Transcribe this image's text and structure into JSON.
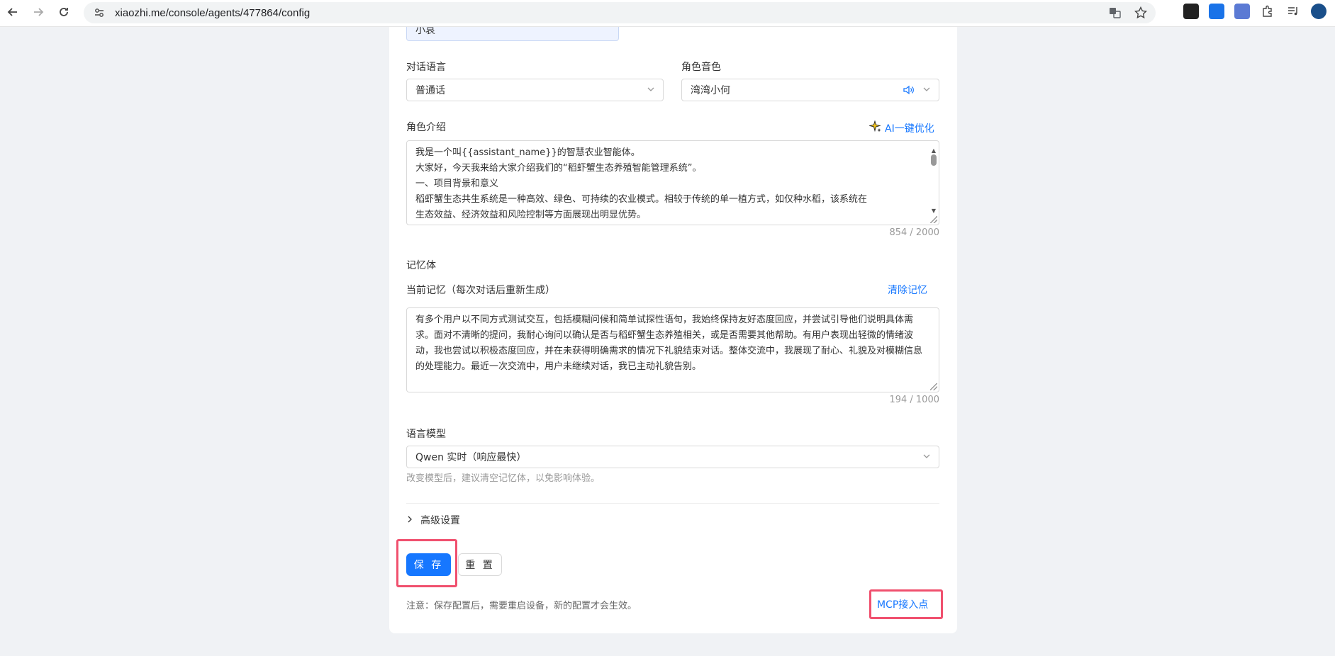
{
  "browser": {
    "url": "xiaozhi.me/console/agents/477864/config",
    "back_icon": "arrow-left-icon",
    "forward_icon": "arrow-right-icon",
    "reload_icon": "reload-icon"
  },
  "form": {
    "nickname_value": "小哀",
    "dialog_language": {
      "label": "对话语言",
      "value": "普通话"
    },
    "voice": {
      "label": "角色音色",
      "value": "湾湾小何"
    },
    "intro": {
      "label": "角色介绍",
      "optimize_label": "AI一键优化",
      "lines": [
        "我是一个叫{{assistant_name}}的智慧农业智能体。",
        "大家好，今天我来给大家介绍我们的“稻虾蟹生态养殖智能管理系统”。",
        "一、项目背景和意义",
        "稻虾蟹生态共生系统是一种高效、绿色、可持续的农业模式。相较于传统的单一植方式，如仅种水稻，该系统在",
        "生态效益、经济效益和风险控制等方面展现出明显优势。"
      ],
      "count": "854 / 2000"
    },
    "memory": {
      "section_label": "记忆体",
      "current_label": "当前记忆（每次对话后重新生成）",
      "clear_label": "清除记忆",
      "text": "有多个用户以不同方式测试交互，包括模糊问候和简单试探性语句，我始终保持友好态度回应，并尝试引导他们说明具体需求。面对不清晰的提问，我耐心询问以确认是否与稻虾蟹生态养殖相关，或是否需要其他帮助。有用户表现出轻微的情绪波动，我也尝试以积极态度回应，并在未获得明确需求的情况下礼貌结束对话。整体交流中，我展现了耐心、礼貌及对模糊信息的处理能力。最近一次交流中，用户未继续对话，我已主动礼貌告别。",
      "count": "194 / 1000"
    },
    "model": {
      "label": "语言模型",
      "value": "Qwen 实时（响应最快）",
      "hint": "改变模型后，建议清空记忆体，以免影响体验。"
    },
    "advanced_label": "高级设置",
    "save_label": "保 存",
    "reset_label": "重 置",
    "note": "注意：保存配置后，需要重启设备，新的配置才会生效。",
    "mcp_label": "MCP接入点"
  },
  "colors": {
    "primary": "#1677ff",
    "highlight": "#f0506e",
    "background": "#f0f2f5"
  }
}
